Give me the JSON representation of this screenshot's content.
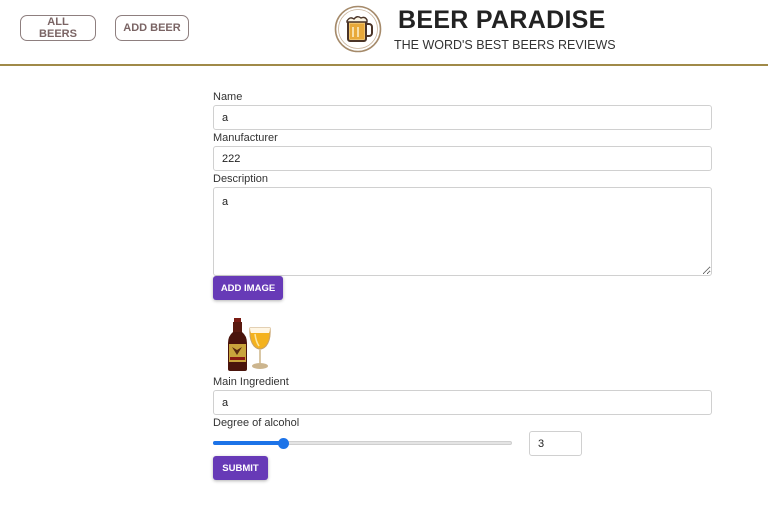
{
  "nav": {
    "all_beers_label": "ALL BEERS",
    "add_beer_label": "ADD BEER"
  },
  "brand": {
    "title": "BEER PARADISE",
    "subtitle": "THE WORD'S BEST BEERS REVIEWS"
  },
  "form": {
    "name": {
      "label": "Name",
      "value": "a"
    },
    "manufacturer": {
      "label": "Manufacturer",
      "value": "222"
    },
    "description": {
      "label": "Description",
      "value": "a"
    },
    "add_image_label": "ADD IMAGE",
    "main_ingredient": {
      "label": "Main Ingredient",
      "value": "a"
    },
    "alcohol": {
      "label": "Degree of alcohol",
      "value": "3",
      "slider_fraction": 0.235
    },
    "submit_label": "SUBMIT"
  },
  "colors": {
    "accent_purple": "#673ab7",
    "slider_blue": "#1c73e8",
    "header_rule": "#a08a48",
    "nav_border": "#8e7f7f"
  },
  "icons": {
    "logo": "beer-mug-icon",
    "preview": "beer-bottle-glass-image"
  }
}
